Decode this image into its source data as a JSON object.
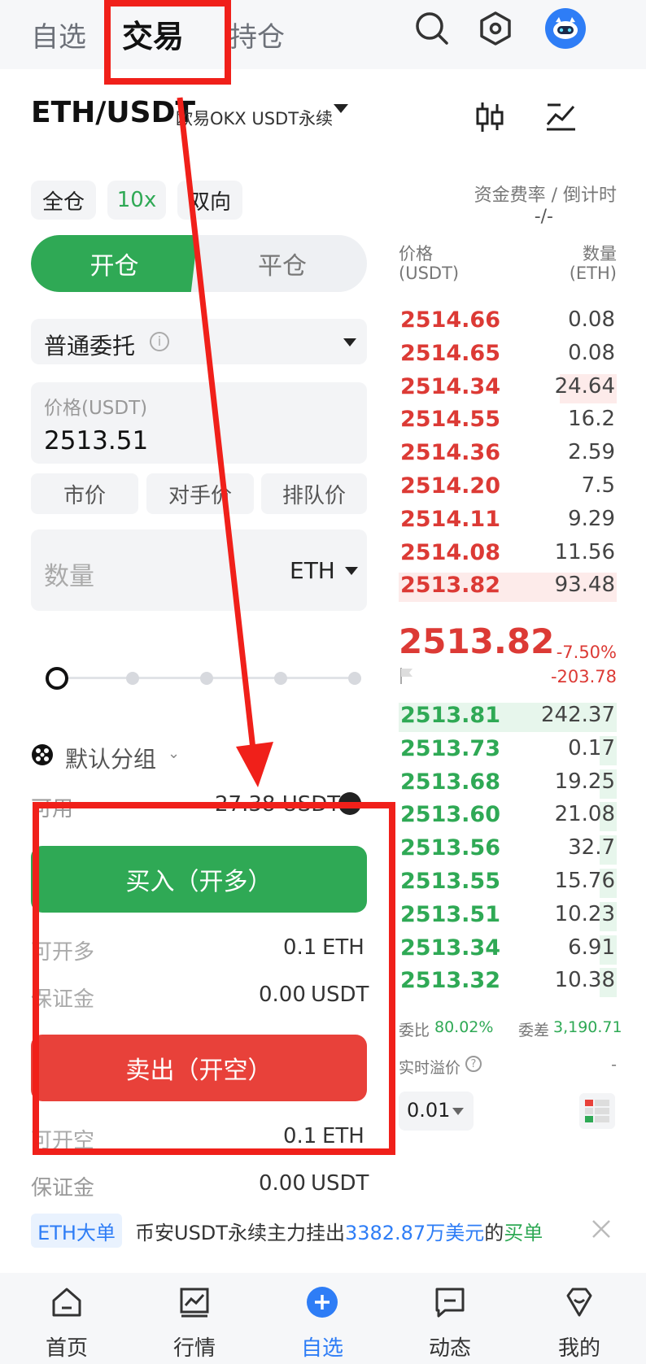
{
  "top_tabs": [
    {
      "label": "自选"
    },
    {
      "label": "交易"
    },
    {
      "label": "持仓"
    }
  ],
  "header_icons": {
    "search": "search-icon",
    "settings": "hexagon-settings-icon",
    "avatar": "robot-avatar"
  },
  "pair": {
    "symbol": "ETH/USDT",
    "exchange": "欧易OKX USDT永续",
    "chart_icon": "candlestick-icon",
    "trend_icon": "trend-chart-icon"
  },
  "mode_pills": {
    "margin": "全仓",
    "leverage": "10x",
    "position_mode": "双向"
  },
  "funding": {
    "label": "资金费率 / 倒计时",
    "value": "-/-"
  },
  "open_close": {
    "open": "开仓",
    "close": "平仓"
  },
  "order_type": {
    "label": "普通委托",
    "info_icon": "info-icon"
  },
  "price_field": {
    "label": "价格(USDT)",
    "value": "2513.51"
  },
  "quick_price": [
    "市价",
    "对手价",
    "排队价"
  ],
  "quantity_field": {
    "placeholder": "数量",
    "unit": "ETH"
  },
  "slider": {
    "level_percent": 0
  },
  "group": {
    "icon": "dice-icon",
    "label": "默认分组"
  },
  "available": {
    "label": "可用",
    "value": "27.38 USDT"
  },
  "buy": {
    "button": "买入（开多）",
    "max_open_label": "可开多",
    "max_open_value": "0.1",
    "max_open_unit": "ETH",
    "margin_label": "保证金",
    "margin_value": "0.00",
    "margin_unit": "USDT"
  },
  "sell": {
    "button": "卖出（开空）",
    "max_open_label": "可开空",
    "max_open_value": "0.1",
    "max_open_unit": "ETH",
    "margin_label": "保证金",
    "margin_value": "0.00",
    "margin_unit": "USDT"
  },
  "orderbook": {
    "price_header": "价格",
    "price_unit": "(USDT)",
    "qty_header": "数量",
    "qty_unit": "(ETH)",
    "asks": [
      {
        "price": "2514.66",
        "qty": "0.08",
        "depth": 0.0
      },
      {
        "price": "2514.65",
        "qty": "0.08",
        "depth": 0.0
      },
      {
        "price": "2514.34",
        "qty": "24.64",
        "depth": 0.26
      },
      {
        "price": "2514.55",
        "qty": "16.2",
        "depth": 0.0
      },
      {
        "price": "2514.36",
        "qty": "2.59",
        "depth": 0.0
      },
      {
        "price": "2514.20",
        "qty": "7.5",
        "depth": 0.0
      },
      {
        "price": "2514.11",
        "qty": "9.29",
        "depth": 0.0
      },
      {
        "price": "2514.08",
        "qty": "11.56",
        "depth": 0.0
      },
      {
        "price": "2513.82",
        "qty": "93.48",
        "depth": 1.0
      }
    ],
    "last_price": "2513.82",
    "change_percent": "-7.50%",
    "change_value": "-203.78",
    "bids": [
      {
        "price": "2513.81",
        "qty": "242.37",
        "depth": 1.0
      },
      {
        "price": "2513.73",
        "qty": "0.17",
        "depth": 0.08
      },
      {
        "price": "2513.68",
        "qty": "19.25",
        "depth": 0.08
      },
      {
        "price": "2513.60",
        "qty": "21.08",
        "depth": 0.08
      },
      {
        "price": "2513.56",
        "qty": "32.7",
        "depth": 0.08
      },
      {
        "price": "2513.55",
        "qty": "15.76",
        "depth": 0.08
      },
      {
        "price": "2513.51",
        "qty": "10.23",
        "depth": 0.08
      },
      {
        "price": "2513.34",
        "qty": "6.91",
        "depth": 0.08
      },
      {
        "price": "2513.32",
        "qty": "10.38",
        "depth": 0.08
      }
    ],
    "ratio_label": "委比",
    "ratio_value": "80.02%",
    "diff_label": "委差",
    "diff_value": "3,190.71",
    "premium_label": "实时溢价",
    "premium_value": "-",
    "precision": "0.01"
  },
  "banner": {
    "tag": "ETH大单",
    "text_a": "币安USDT永续主力挂出",
    "amount": "3382.87万美元",
    "text_b": "的",
    "side": "买单"
  },
  "bottom_nav": [
    {
      "label": "首页",
      "icon": "home-icon"
    },
    {
      "label": "行情",
      "icon": "market-chart-icon"
    },
    {
      "label": "自选",
      "icon": "add-circle-icon"
    },
    {
      "label": "动态",
      "icon": "message-icon"
    },
    {
      "label": "我的",
      "icon": "profile-heart-icon"
    }
  ],
  "colors": {
    "green": "#2fa955",
    "red": "#dc3a35",
    "blue": "#2e7df6",
    "annotation": "#f0201a"
  }
}
